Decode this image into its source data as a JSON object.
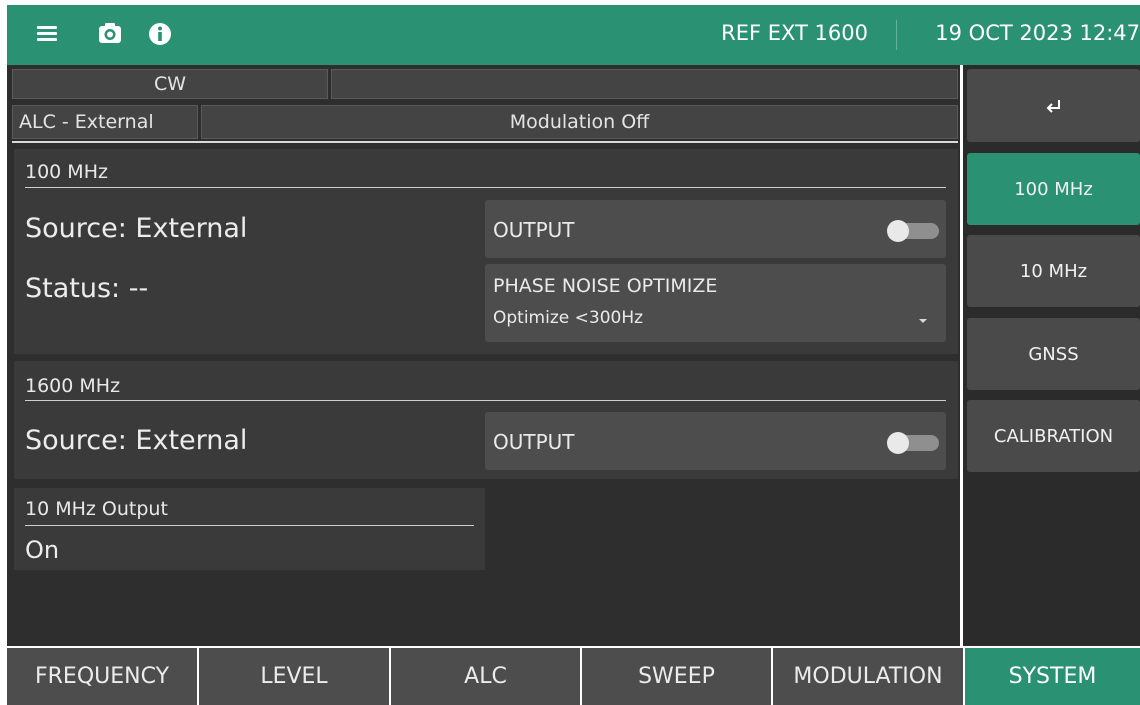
{
  "topbar": {
    "reference": "REF EXT 1600",
    "datetime": "19 OCT 2023 12:47",
    "icons": [
      "menu-icon",
      "camera-icon",
      "info-icon"
    ]
  },
  "status": {
    "mode": "CW",
    "mode_extra": "",
    "alc": "ALC - External",
    "modulation": "Modulation Off"
  },
  "section_100": {
    "title": "100 MHz",
    "source": "Source: External",
    "status": "Status: --",
    "output_label": "OUTPUT",
    "output_on": false,
    "phase_noise_label": "PHASE NOISE OPTIMIZE",
    "phase_noise_value": "Optimize <300Hz"
  },
  "section_1600": {
    "title": "1600 MHz",
    "source": "Source: External",
    "output_label": "OUTPUT",
    "output_on": false
  },
  "ten_mhz_output": {
    "title": "10 MHz Output",
    "value": "On"
  },
  "side": {
    "back_icon": "back-arrow-icon",
    "items": [
      {
        "label": "100 MHz",
        "active": true
      },
      {
        "label": "10 MHz",
        "active": false
      },
      {
        "label": "GNSS",
        "active": false
      },
      {
        "label": "CALIBRATION",
        "active": false
      }
    ]
  },
  "tabs": [
    {
      "label": "FREQUENCY",
      "active": false
    },
    {
      "label": "LEVEL",
      "active": false
    },
    {
      "label": "ALC",
      "active": false
    },
    {
      "label": "SWEEP",
      "active": false
    },
    {
      "label": "MODULATION",
      "active": false
    },
    {
      "label": "SYSTEM",
      "active": true
    }
  ],
  "colors": {
    "accent": "#2a9273",
    "panel": "#2e2e2e",
    "button": "#4d4d4d"
  }
}
